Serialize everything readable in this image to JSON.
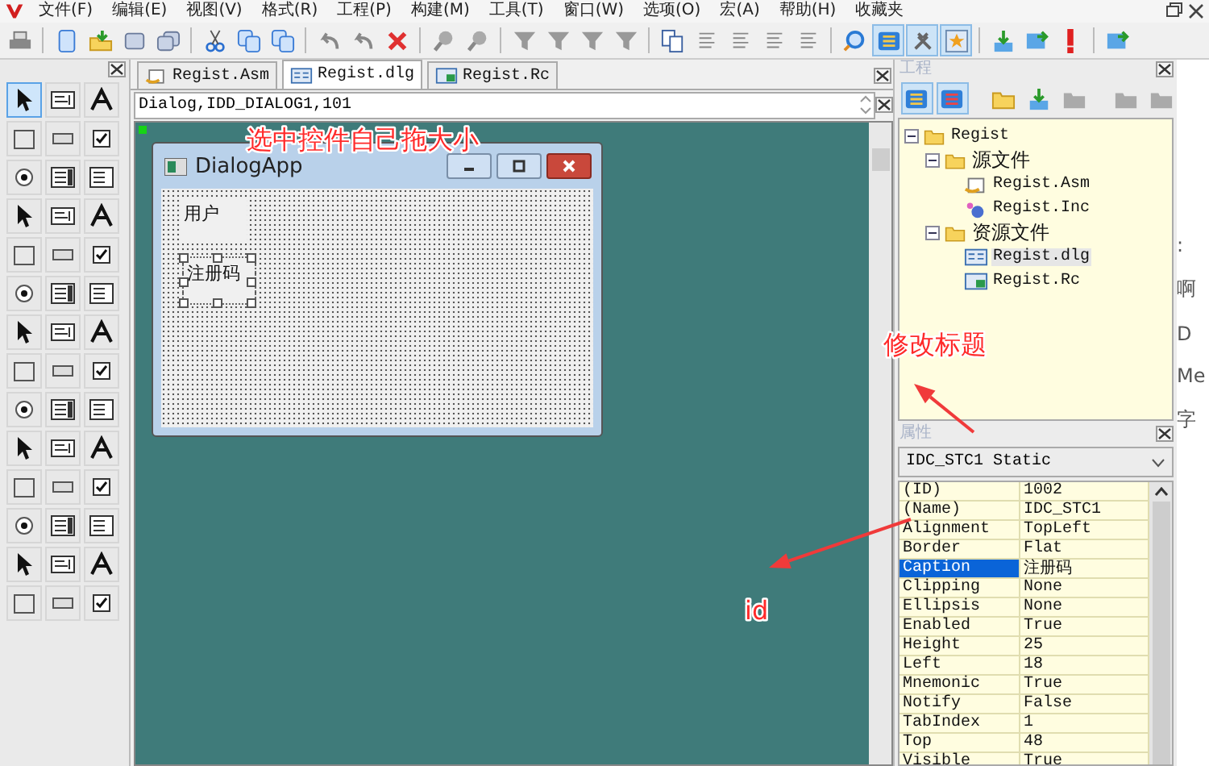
{
  "menu": [
    "文件(F)",
    "编辑(E)",
    "视图(V)",
    "格式(R)",
    "工程(P)",
    "构建(M)",
    "工具(T)",
    "窗口(W)",
    "选项(O)",
    "宏(A)",
    "帮助(H)",
    "收藏夹"
  ],
  "toolbox": {
    "tools": [
      {
        "selected": true
      },
      {
        "selected": false
      },
      {
        "selected": false
      },
      {
        "selected": false
      },
      {
        "selected": false
      },
      {
        "selected": false
      },
      {
        "selected": false
      },
      {
        "selected": false
      },
      {
        "selected": false
      },
      {
        "selected": false
      },
      {
        "selected": false
      },
      {
        "selected": false
      },
      {
        "selected": false
      },
      {
        "selected": false
      },
      {
        "selected": false
      },
      {
        "selected": false
      },
      {
        "selected": false
      },
      {
        "selected": false
      },
      {
        "selected": false
      },
      {
        "selected": false
      },
      {
        "selected": false
      },
      {
        "selected": false
      },
      {
        "selected": false
      },
      {
        "selected": false
      },
      {
        "selected": false
      },
      {
        "selected": false
      },
      {
        "selected": false
      },
      {
        "selected": false
      },
      {
        "selected": false
      },
      {
        "selected": false
      },
      {
        "selected": false
      },
      {
        "selected": false
      },
      {
        "selected": false
      },
      {
        "selected": false
      },
      {
        "selected": false
      },
      {
        "selected": false
      },
      {
        "selected": false
      },
      {
        "selected": false
      },
      {
        "selected": false
      },
      {
        "selected": false
      },
      {
        "selected": false
      },
      {
        "selected": false
      }
    ]
  },
  "editor": {
    "tabs": [
      {
        "label": "Regist.Asm",
        "kind": "asm",
        "selected": false
      },
      {
        "label": "Regist.dlg",
        "kind": "dlg",
        "selected": true
      },
      {
        "label": "Regist.Rc",
        "kind": "rc",
        "selected": false
      }
    ],
    "resource_line": "Dialog,IDD_DIALOG1,101",
    "dialog": {
      "title": "DialogApp",
      "controls": [
        {
          "text": "用户",
          "selected": false
        },
        {
          "text": "注册码",
          "selected": true
        }
      ]
    }
  },
  "project_panel": {
    "title": "工程",
    "tree": [
      {
        "label": "Regist",
        "expanded": true,
        "selected": false,
        "children": [
          {
            "label": "源文件",
            "expanded": true,
            "selected": false,
            "children": [
              {
                "label": "Regist.Asm",
                "kind": "asm",
                "selected": false
              },
              {
                "label": "Regist.Inc",
                "kind": "inc",
                "selected": false
              }
            ]
          },
          {
            "label": "资源文件",
            "expanded": true,
            "selected": false,
            "children": [
              {
                "label": "Regist.dlg",
                "kind": "dlg",
                "selected": true
              },
              {
                "label": "Regist.Rc",
                "kind": "rc",
                "selected": false
              }
            ]
          }
        ]
      }
    ]
  },
  "properties_panel": {
    "title": "属性",
    "object": "IDC_STC1 Static",
    "rows": [
      {
        "name": "(ID)",
        "value": "1002",
        "selected": false
      },
      {
        "name": "(Name)",
        "value": "IDC_STC1",
        "selected": false
      },
      {
        "name": "Alignment",
        "value": "TopLeft",
        "selected": false
      },
      {
        "name": "Border",
        "value": "Flat",
        "selected": false
      },
      {
        "name": "Caption",
        "value": "注册码",
        "selected": true
      },
      {
        "name": "Clipping",
        "value": "None",
        "selected": false
      },
      {
        "name": "Ellipsis",
        "value": "None",
        "selected": false
      },
      {
        "name": "Enabled",
        "value": "True",
        "selected": false
      },
      {
        "name": "Height",
        "value": "25",
        "selected": false
      },
      {
        "name": "Left",
        "value": "18",
        "selected": false
      },
      {
        "name": "Mnemonic",
        "value": "True",
        "selected": false
      },
      {
        "name": "Notify",
        "value": "False",
        "selected": false
      },
      {
        "name": "TabIndex",
        "value": "1",
        "selected": false
      },
      {
        "name": "Top",
        "value": "48",
        "selected": false
      },
      {
        "name": "Visible",
        "value": "True",
        "selected": false
      }
    ]
  },
  "background_window": {
    "fragments": [
      ":",
      "啊",
      "D",
      "Me",
      "字"
    ]
  },
  "annotations": [
    {
      "text": "选中控件自己拖大小"
    },
    {
      "text": "修改标题"
    },
    {
      "text": "id"
    }
  ]
}
